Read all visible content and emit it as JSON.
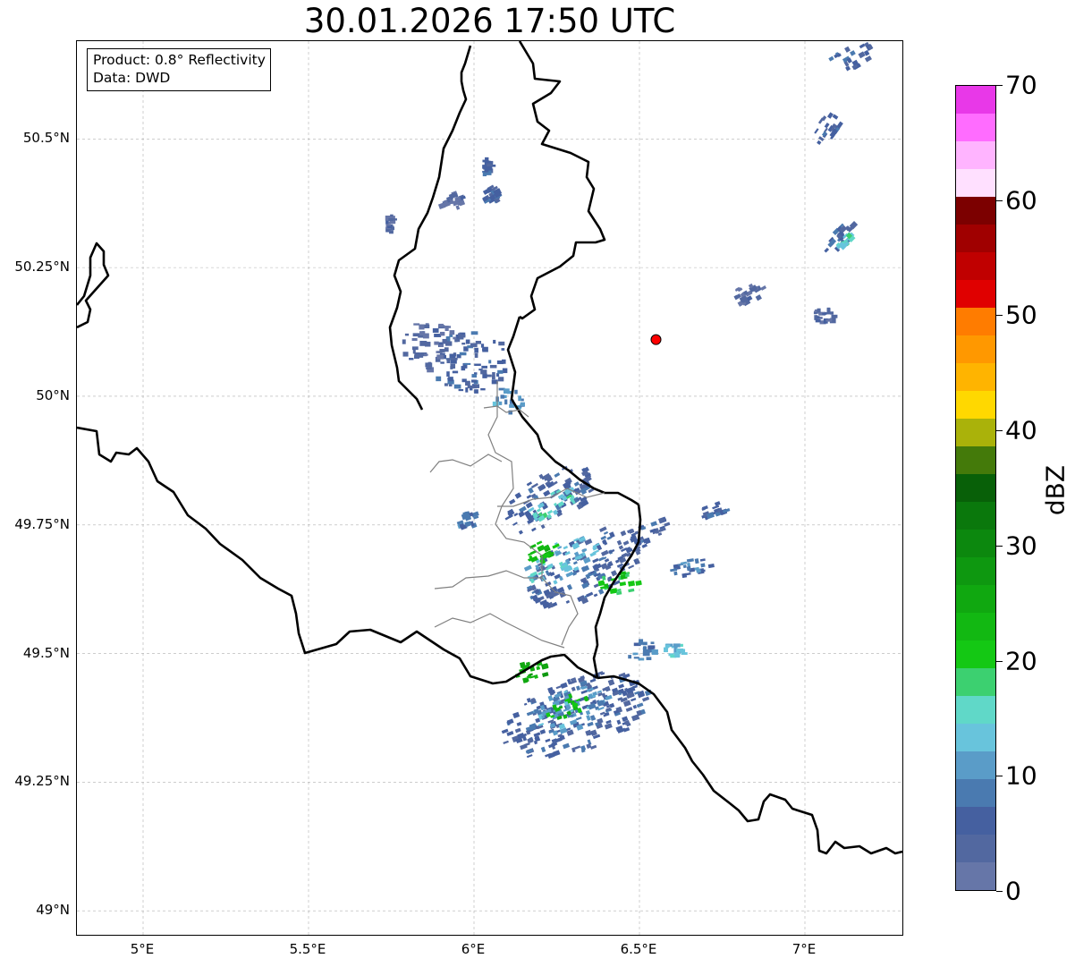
{
  "title": "30.01.2026 17:50 UTC",
  "info": {
    "product": "Product: 0.8° Reflectivity",
    "data_source": "Data: DWD"
  },
  "lat_labels": [
    "50.5°N",
    "50.25°N",
    "50°N",
    "49.75°N",
    "49.5°N",
    "49.25°N",
    "49°N"
  ],
  "lon_labels": [
    "5°E",
    "5.5°E",
    "6°E",
    "6.5°E",
    "7°E"
  ],
  "colorbar": {
    "unit": "dBZ",
    "tick_labels": [
      "0",
      "10",
      "20",
      "30",
      "40",
      "50",
      "60",
      "70"
    ],
    "colors": [
      "#6676a8",
      "#5268a0",
      "#4560a0",
      "#4a7ab0",
      "#5a9cc8",
      "#68c4dc",
      "#60d8c8",
      "#3cd070",
      "#14c814",
      "#12b812",
      "#10a810",
      "#0e9810",
      "#0c880e",
      "#0a780c",
      "#086008",
      "#447a0a",
      "#aab20a",
      "#ffd800",
      "#ffb400",
      "#ff9800",
      "#ff7c00",
      "#e00000",
      "#c00000",
      "#a00000",
      "#7c0000",
      "#ffe0ff",
      "#ffb4ff",
      "#ff6cff",
      "#e838e8"
    ]
  },
  "station": {
    "name": "radar-site",
    "lon": 6.55,
    "lat": 50.11
  },
  "echoes": [
    {
      "lon": 6.3,
      "lat": 49.38,
      "rlon": 0.24,
      "rlat": 0.07,
      "rot": -20,
      "level": 2
    },
    {
      "lon": 6.28,
      "lat": 49.39,
      "rlon": 0.13,
      "rlat": 0.04,
      "rot": -20,
      "level": 4
    },
    {
      "lon": 6.27,
      "lat": 49.4,
      "rlon": 0.07,
      "rlat": 0.02,
      "rot": -20,
      "level": 9
    },
    {
      "lon": 6.17,
      "lat": 49.47,
      "rlon": 0.05,
      "rlat": 0.02,
      "rot": -15,
      "level": 10
    },
    {
      "lon": 6.33,
      "lat": 49.67,
      "rlon": 0.2,
      "rlat": 0.06,
      "rot": -25,
      "level": 2
    },
    {
      "lon": 6.25,
      "lat": 49.68,
      "rlon": 0.12,
      "rlat": 0.035,
      "rot": -25,
      "level": 5
    },
    {
      "lon": 6.2,
      "lat": 49.7,
      "rlon": 0.05,
      "rlat": 0.02,
      "rot": -25,
      "level": 9
    },
    {
      "lon": 6.43,
      "lat": 49.64,
      "rlon": 0.06,
      "rlat": 0.025,
      "rot": -10,
      "level": 8
    },
    {
      "lon": 6.22,
      "lat": 49.8,
      "rlon": 0.15,
      "rlat": 0.05,
      "rot": -30,
      "level": 2
    },
    {
      "lon": 6.23,
      "lat": 49.79,
      "rlon": 0.08,
      "rlat": 0.025,
      "rot": -30,
      "level": 6
    },
    {
      "lon": 5.98,
      "lat": 50.07,
      "rlon": 0.12,
      "rlat": 0.06,
      "rot": 0,
      "level": 2
    },
    {
      "lon": 5.86,
      "lat": 50.1,
      "rlon": 0.08,
      "rlat": 0.05,
      "rot": 0,
      "level": 1
    },
    {
      "lon": 6.1,
      "lat": 50.0,
      "rlon": 0.05,
      "rlat": 0.03,
      "rot": 0,
      "level": 4
    },
    {
      "lon": 6.52,
      "lat": 49.74,
      "rlon": 0.07,
      "rlat": 0.02,
      "rot": -20,
      "level": 2
    },
    {
      "lon": 6.65,
      "lat": 49.67,
      "rlon": 0.06,
      "rlat": 0.015,
      "rot": -10,
      "level": 3
    },
    {
      "lon": 6.5,
      "lat": 49.51,
      "rlon": 0.05,
      "rlat": 0.02,
      "rot": 0,
      "level": 3
    },
    {
      "lon": 6.6,
      "lat": 49.51,
      "rlon": 0.03,
      "rlat": 0.015,
      "rot": 0,
      "level": 5
    },
    {
      "lon": 7.06,
      "lat": 50.52,
      "rlon": 0.05,
      "rlat": 0.02,
      "rot": -55,
      "level": 2
    },
    {
      "lon": 7.1,
      "lat": 50.31,
      "rlon": 0.06,
      "rlat": 0.015,
      "rot": -45,
      "level": 2
    },
    {
      "lon": 7.11,
      "lat": 50.3,
      "rlon": 0.025,
      "rlat": 0.008,
      "rot": -45,
      "level": 6
    },
    {
      "lon": 7.13,
      "lat": 50.66,
      "rlon": 0.07,
      "rlat": 0.025,
      "rot": -30,
      "level": 2
    },
    {
      "lon": 5.93,
      "lat": 50.38,
      "rlon": 0.05,
      "rlat": 0.015,
      "rot": -20,
      "level": 1
    },
    {
      "lon": 6.04,
      "lat": 50.39,
      "rlon": 0.03,
      "rlat": 0.015,
      "rot": -30,
      "level": 2
    },
    {
      "lon": 6.03,
      "lat": 50.45,
      "rlon": 0.015,
      "rlat": 0.015,
      "rot": 0,
      "level": 2
    },
    {
      "lon": 5.74,
      "lat": 50.34,
      "rlon": 0.01,
      "rlat": 0.02,
      "rot": 0,
      "level": 1
    },
    {
      "lon": 6.82,
      "lat": 50.2,
      "rlon": 0.05,
      "rlat": 0.02,
      "rot": -30,
      "level": 1
    },
    {
      "lon": 7.05,
      "lat": 50.16,
      "rlon": 0.03,
      "rlat": 0.015,
      "rot": 0,
      "level": 1
    },
    {
      "lon": 6.72,
      "lat": 49.78,
      "rlon": 0.04,
      "rlat": 0.015,
      "rot": -20,
      "level": 2
    },
    {
      "lon": 5.97,
      "lat": 49.76,
      "rlon": 0.03,
      "rlat": 0.015,
      "rot": -20,
      "level": 3
    }
  ],
  "legend_levels_note_hidden": null
}
